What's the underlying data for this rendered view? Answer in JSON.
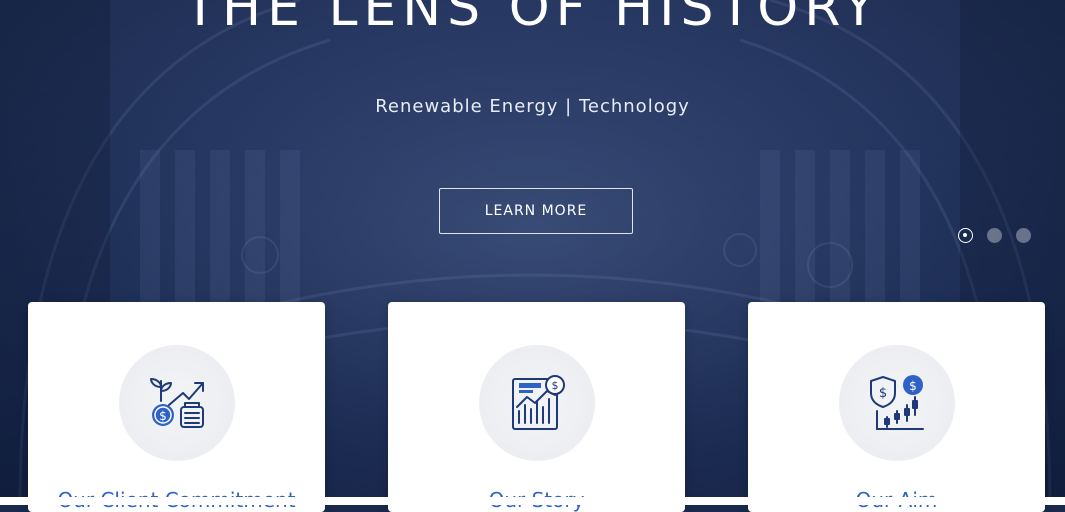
{
  "hero": {
    "title": "THE LENS OF HISTORY",
    "subtitle": "Renewable Energy | Technology",
    "cta_label": "LEARN MORE",
    "slide_count": 3,
    "active_slide": 1
  },
  "cards": [
    {
      "title": "Our Client Commitment",
      "icon": "growth-investment-icon"
    },
    {
      "title": "Our Story",
      "icon": "financial-report-icon"
    },
    {
      "title": "Our Aim",
      "icon": "secure-investment-chart-icon"
    }
  ],
  "colors": {
    "accent": "#2f62c6",
    "hero_overlay": "#22345c",
    "card_bg": "#ffffff",
    "icon_stroke": "#1e3a7a"
  }
}
